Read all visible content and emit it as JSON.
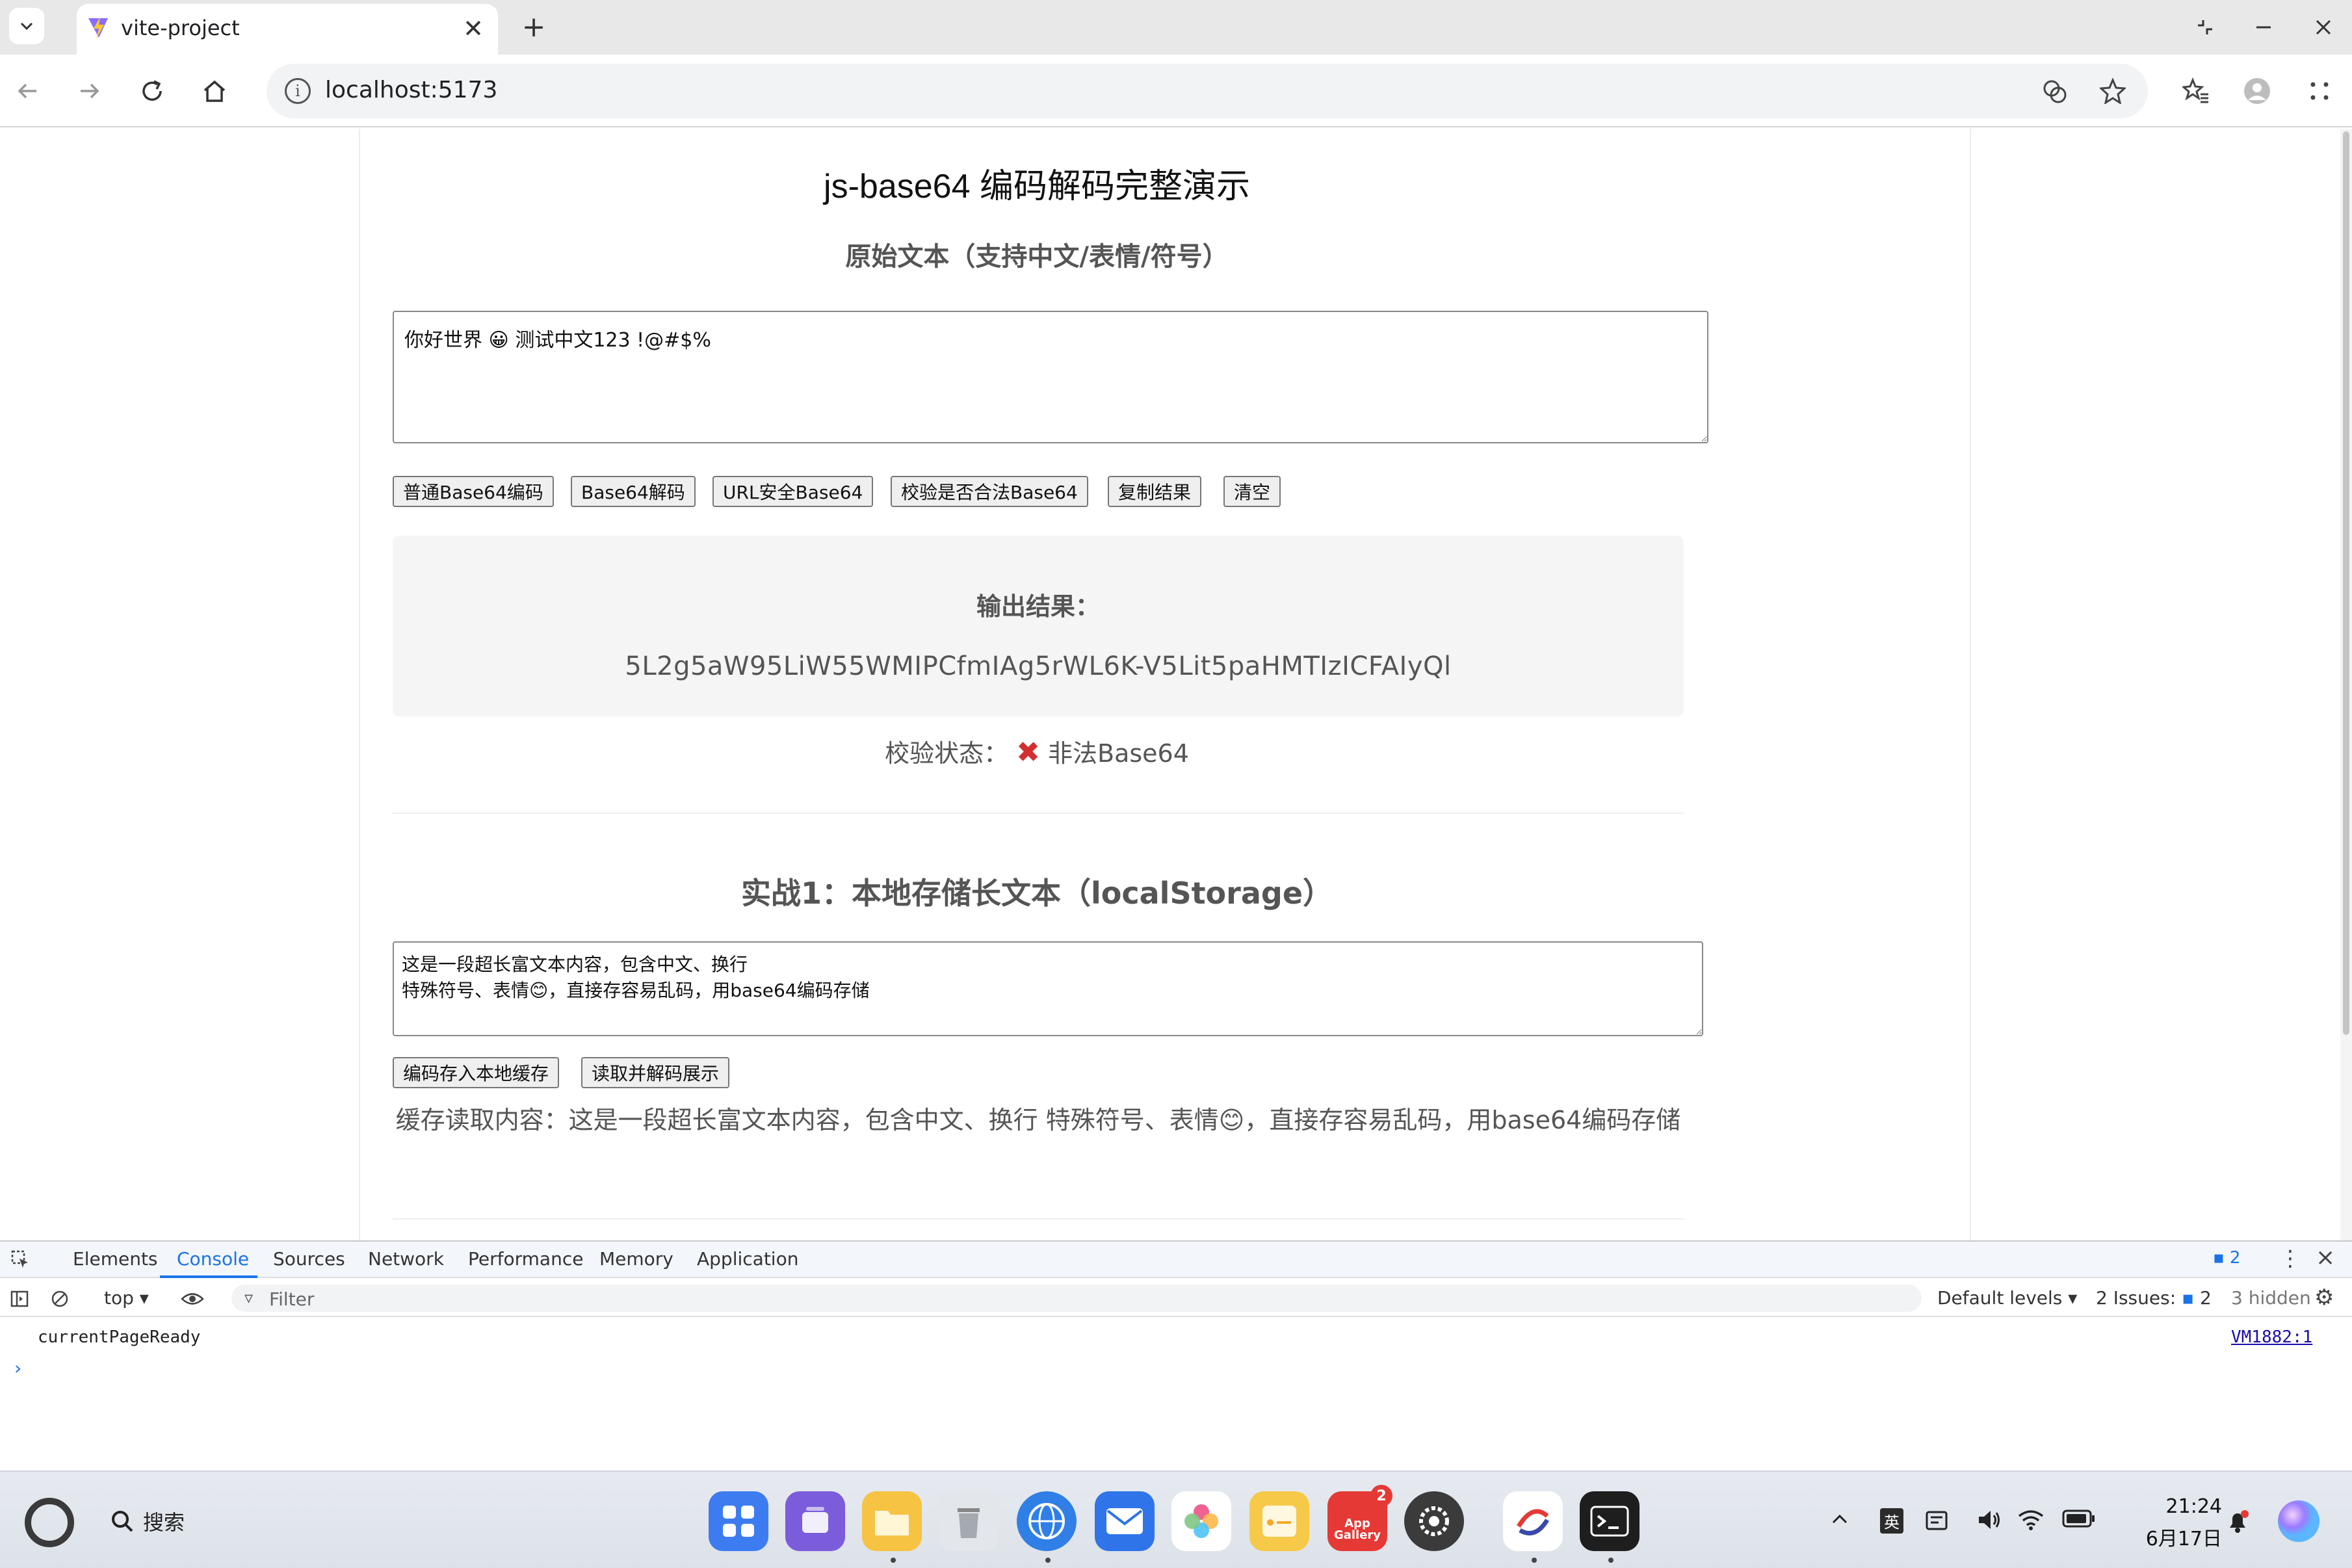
{
  "browser": {
    "tab_title": "vite-project",
    "url": "localhost:5173",
    "new_tab": "+",
    "tab_close": "✕"
  },
  "page": {
    "title": "js-base64 编码解码完整演示",
    "original_label": "原始文本（支持中文/表情/符号）",
    "original_text": "你好世界 😀 测试中文123 !@#$%",
    "buttons": [
      "普通Base64编码",
      "Base64解码",
      "URL安全Base64",
      "校验是否合法Base64",
      "复制结果",
      "清空"
    ],
    "result_label": "输出结果：",
    "result_value": "5L2g5aW95LiW55WMIPCfmIAg5rWL6K-V5Lit5paHMTIzICFAIyQl",
    "valid_prefix": "校验状态：",
    "valid_status": "非法Base64",
    "section1_title": "实战1：本地存储长文本（localStorage）",
    "long_text": "这是一段超长富文本内容，包含中文、换行\n特殊符号、表情😊，直接存容易乱码，用base64编码存储",
    "store_button": "编码存入本地缓存",
    "read_button": "读取并解码展示",
    "cache_read": "缓存读取内容：这是一段超长富文本内容，包含中文、换行 特殊符号、表情😊，直接存容易乱码，用base64编码存储"
  },
  "devtools": {
    "tabs": [
      "Elements",
      "Console",
      "Sources",
      "Network",
      "Performance",
      "Memory",
      "Application"
    ],
    "issues_badge": "2",
    "context": "top ▾",
    "filter_placeholder": "Filter",
    "levels": "Default levels ▾",
    "issues_label": "2 Issues:",
    "issues_count": "2",
    "hidden": "3 hidden",
    "log_message": "currentPageReady",
    "log_source": "VM1882:1",
    "prompt": "›"
  },
  "taskbar": {
    "search_label": "搜索",
    "app_gallery_label": "App Gallery",
    "app_gallery_badge": "2",
    "ime": "英",
    "time": "21:24",
    "date": "6月17日"
  },
  "colors": {
    "accent": "#1a73e8",
    "error": "#d32f2f",
    "result_bg": "#f5f5f5"
  }
}
